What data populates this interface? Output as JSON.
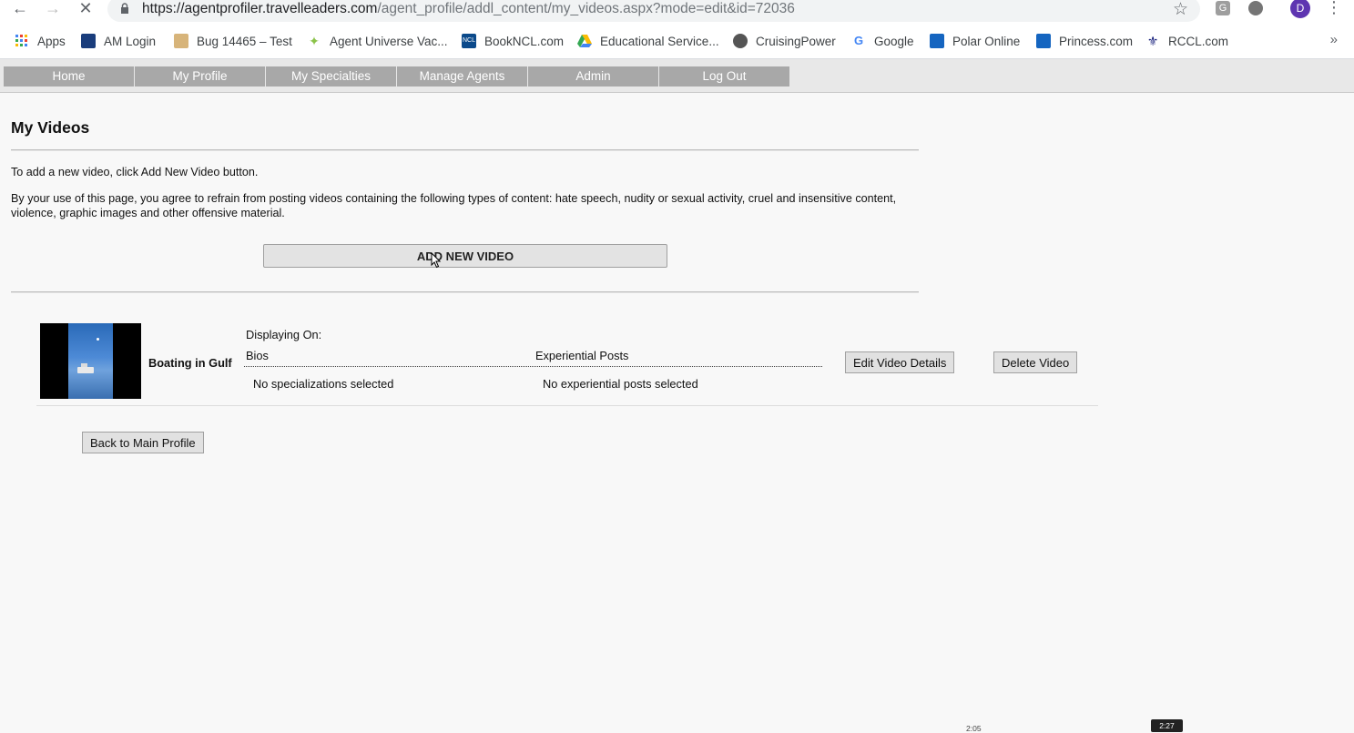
{
  "browser": {
    "url_host": "https://agentprofiler.travelleaders.com",
    "url_path": "/agent_profile/addl_content/my_videos.aspx?mode=edit&id=72036",
    "avatar_letter": "D",
    "ext1_letter": "G",
    "bookmarks": [
      {
        "label": "Apps",
        "icon": "apps-grid-icon",
        "color": "#4285f4"
      },
      {
        "label": "AM Login",
        "icon": "am-login-icon",
        "color": "#1a3d7c"
      },
      {
        "label": "Bug 14465 – Test",
        "icon": "bug-icon",
        "color": "#c9a15a"
      },
      {
        "label": "Agent Universe Vac...",
        "icon": "star-burst-icon",
        "color": "#8bc34a"
      },
      {
        "label": "BookNCL.com",
        "icon": "ncl-icon",
        "color": "#0b4a8b"
      },
      {
        "label": "Educational Service...",
        "icon": "google-drive-icon",
        "color": "#fbbc05"
      },
      {
        "label": "CruisingPower",
        "icon": "globe-icon",
        "color": "#555555"
      },
      {
        "label": "Google",
        "icon": "google-icon",
        "color": "#4285f4"
      },
      {
        "label": "Polar Online",
        "icon": "polar-icon",
        "color": "#1565c0"
      },
      {
        "label": "Princess.com",
        "icon": "princess-icon",
        "color": "#1565c0"
      },
      {
        "label": "RCCL.com",
        "icon": "rccl-icon",
        "color": "#1a237e"
      }
    ],
    "more_label": "»"
  },
  "site_nav": {
    "tabs": [
      "Home",
      "My Profile",
      "My Specialties",
      "Manage Agents",
      "Admin",
      "Log Out"
    ]
  },
  "page": {
    "title": "My Videos",
    "instruction": "To add a new video, click Add New Video button.",
    "agreement": "By your use of this page, you agree to refrain from posting videos containing the following types of content: hate speech, nudity or sexual activity, cruel and insensitive content, violence, graphic images and other offensive material.",
    "add_button": "ADD NEW VIDEO"
  },
  "video": {
    "title": "Boating in Gulf",
    "displaying_on_label": "Displaying On:",
    "bios_header": "Bios",
    "posts_header": "Experiential Posts",
    "bios_value": "No specializations selected",
    "posts_value": "No experiential posts selected",
    "edit_button": "Edit Video Details",
    "delete_button": "Delete Video"
  },
  "back_button": "Back to Main Profile",
  "timestamps": {
    "left": "2:05",
    "right": "2:27"
  }
}
